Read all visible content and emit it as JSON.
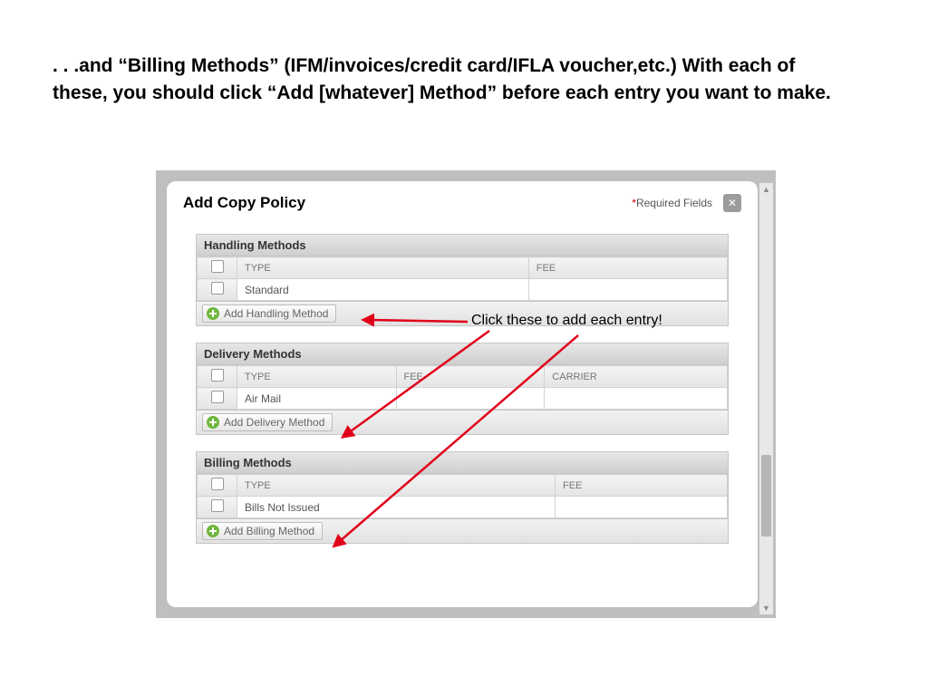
{
  "slide": {
    "text": ". . .and “Billing Methods” (IFM/invoices/credit card/IFLA voucher,etc.)  With each of these, you should click “Add [whatever] Method” before each entry you want to make."
  },
  "modal": {
    "title": "Add Copy Policy",
    "required_fields": "Required Fields"
  },
  "annotation": {
    "click_text": "Click these to add each entry!"
  },
  "handling": {
    "title": "Handling Methods",
    "col_type": "TYPE",
    "col_fee": "FEE",
    "rows": [
      {
        "type": "Standard",
        "fee": ""
      }
    ],
    "add_label": "Add Handling Method"
  },
  "delivery": {
    "title": "Delivery Methods",
    "col_type": "TYPE",
    "col_fee": "FEE",
    "col_carrier": "CARRIER",
    "rows": [
      {
        "type": "Air Mail",
        "fee": "",
        "carrier": ""
      }
    ],
    "add_label": "Add Delivery Method"
  },
  "billing": {
    "title": "Billing Methods",
    "col_type": "TYPE",
    "col_fee": "FEE",
    "rows": [
      {
        "type": "Bills Not Issued",
        "fee": ""
      }
    ],
    "add_label": "Add Billing Method"
  }
}
